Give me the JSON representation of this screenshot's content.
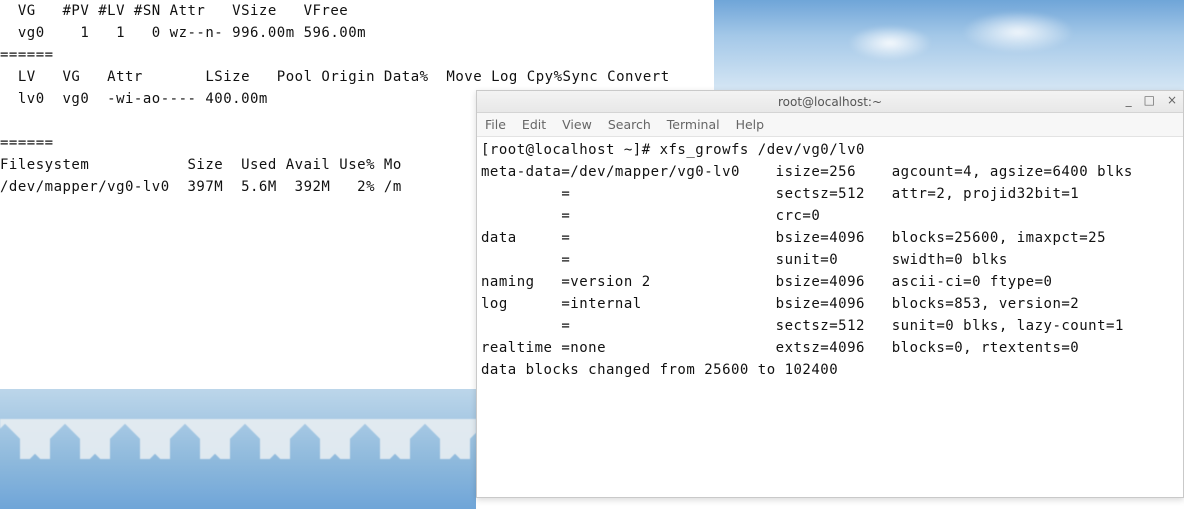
{
  "left_terminal": {
    "lines": [
      "  VG   #PV #LV #SN Attr   VSize   VFree ",
      "  vg0    1   1   0 wz--n- 996.00m 596.00m",
      "======",
      "  LV   VG   Attr       LSize   Pool Origin Data%  Move Log Cpy%Sync Convert",
      "  lv0  vg0  -wi-ao---- 400.00m",
      "",
      "======",
      "Filesystem           Size  Used Avail Use% Mo",
      "/dev/mapper/vg0-lv0  397M  5.6M  392M   2% /m"
    ]
  },
  "right_terminal": {
    "title": "root@localhost:~",
    "menu": [
      "File",
      "Edit",
      "View",
      "Search",
      "Terminal",
      "Help"
    ],
    "command": "[root@localhost ~]# xfs_growfs /dev/vg0/lv0",
    "output_lines": [
      "meta-data=/dev/mapper/vg0-lv0    isize=256    agcount=4, agsize=6400 blks",
      "         =                       sectsz=512   attr=2, projid32bit=1",
      "         =                       crc=0",
      "data     =                       bsize=4096   blocks=25600, imaxpct=25",
      "         =                       sunit=0      swidth=0 blks",
      "naming   =version 2              bsize=4096   ascii-ci=0 ftype=0",
      "log      =internal               bsize=4096   blocks=853, version=2",
      "         =                       sectsz=512   sunit=0 blks, lazy-count=1",
      "realtime =none                   extsz=4096   blocks=0, rtextents=0",
      "data blocks changed from 25600 to 102400"
    ]
  },
  "chart_data": {
    "type": "table",
    "title": "LVM / filesystem state and xfs_growfs output",
    "volume_group": {
      "name": "vg0",
      "pv_count": 1,
      "lv_count": 1,
      "sn_count": 0,
      "attr": "wz--n-",
      "vsize": "996.00m",
      "vfree": "596.00m"
    },
    "logical_volume": {
      "name": "lv0",
      "vg": "vg0",
      "attr": "-wi-ao----",
      "lsize": "400.00m"
    },
    "filesystem_usage": {
      "filesystem": "/dev/mapper/vg0-lv0",
      "size": "397M",
      "used": "5.6M",
      "avail": "392M",
      "use_pct": "2%"
    },
    "xfs_growfs": {
      "device": "/dev/vg0/lv0",
      "meta_data": {
        "target": "/dev/mapper/vg0-lv0",
        "isize": 256,
        "agcount": 4,
        "agsize_blks": 6400,
        "sectsz": 512,
        "attr": 2,
        "projid32bit": 1,
        "crc": 0
      },
      "data": {
        "bsize": 4096,
        "blocks": 25600,
        "imaxpct": 25,
        "sunit": 0,
        "swidth_blks": 0
      },
      "naming": {
        "version": 2,
        "bsize": 4096,
        "ascii_ci": 0,
        "ftype": 0
      },
      "log": {
        "type": "internal",
        "bsize": 4096,
        "blocks": 853,
        "version": 2,
        "sectsz": 512,
        "sunit_blks": 0,
        "lazy_count": 1
      },
      "realtime": {
        "type": "none",
        "extsz": 4096,
        "blocks": 0,
        "rtextents": 0
      },
      "data_blocks_changed": {
        "from": 25600,
        "to": 102400
      }
    }
  }
}
